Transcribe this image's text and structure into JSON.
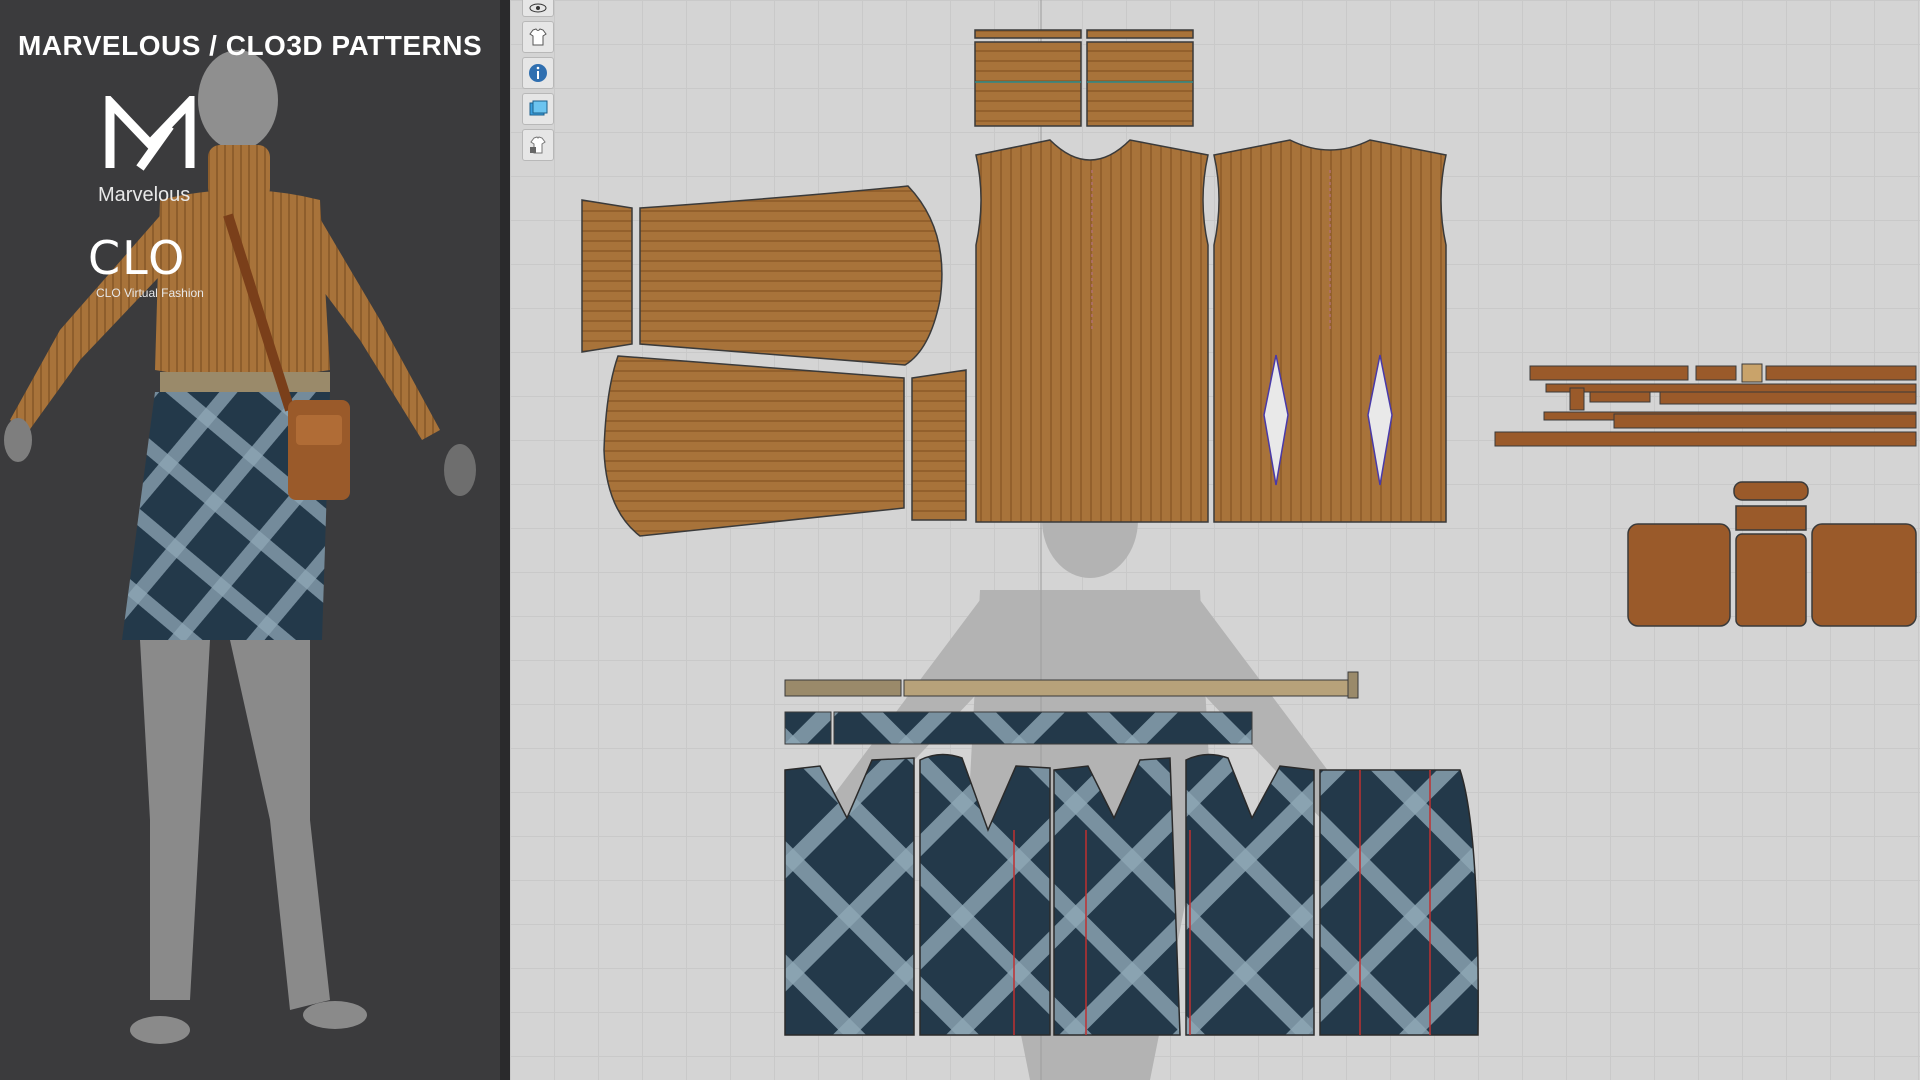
{
  "banner": {
    "title": "MARVELOUS / CLO3D PATTERNS"
  },
  "brands": {
    "marvelous_label": "Marvelous",
    "clo_wordmark": "CLO",
    "clo_label": "CLO Virtual Fashion"
  },
  "toolbar": {
    "buttons": [
      {
        "name": "eye-icon"
      },
      {
        "name": "shirt-visibility-icon"
      },
      {
        "name": "info-icon"
      },
      {
        "name": "texture-icon"
      },
      {
        "name": "lock-garment-icon"
      }
    ]
  },
  "colors": {
    "sweater": "#a8733a",
    "plaid_dark": "#23394a",
    "plaid_light": "#8fa7b5",
    "leather": "#9a5a2a",
    "canvas_bg": "#d4d4d4",
    "panel_bg": "#3b3b3d"
  }
}
